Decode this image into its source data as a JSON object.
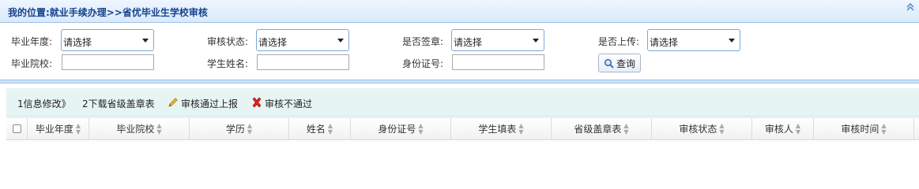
{
  "breadcrumb": "我的位置:就业手续办理>>省优毕业生学校审核",
  "filters": {
    "grad_year_label": "毕业年度:",
    "grad_year_value": "请选择",
    "audit_status_label": "审核状态:",
    "audit_status_value": "请选择",
    "signed_label": "是否签章:",
    "signed_value": "请选择",
    "uploaded_label": "是否上传:",
    "uploaded_value": "请选择",
    "school_label": "毕业院校:",
    "school_value": "",
    "student_name_label": "学生姓名:",
    "student_name_value": "",
    "id_number_label": "身份证号:",
    "id_number_value": "",
    "search_label": "查询"
  },
  "toolbar": {
    "edit_info": "1信息修改》",
    "download_stamp": "2下载省级盖章表",
    "approve": "审核通过上报",
    "reject": "审核不通过"
  },
  "columns": [
    "毕业年度",
    "毕业院校",
    "学历",
    "姓名",
    "身份证号",
    "学生填表",
    "省级盖章表",
    "审核状态",
    "审核人",
    "审核时间"
  ],
  "colors": {
    "title_text": "#15428b",
    "toolbar_bg": "#e6f5f3",
    "select_border": "#7aa7d8",
    "reject_icon": "#e02020",
    "approve_icon": "#e49a2c"
  }
}
